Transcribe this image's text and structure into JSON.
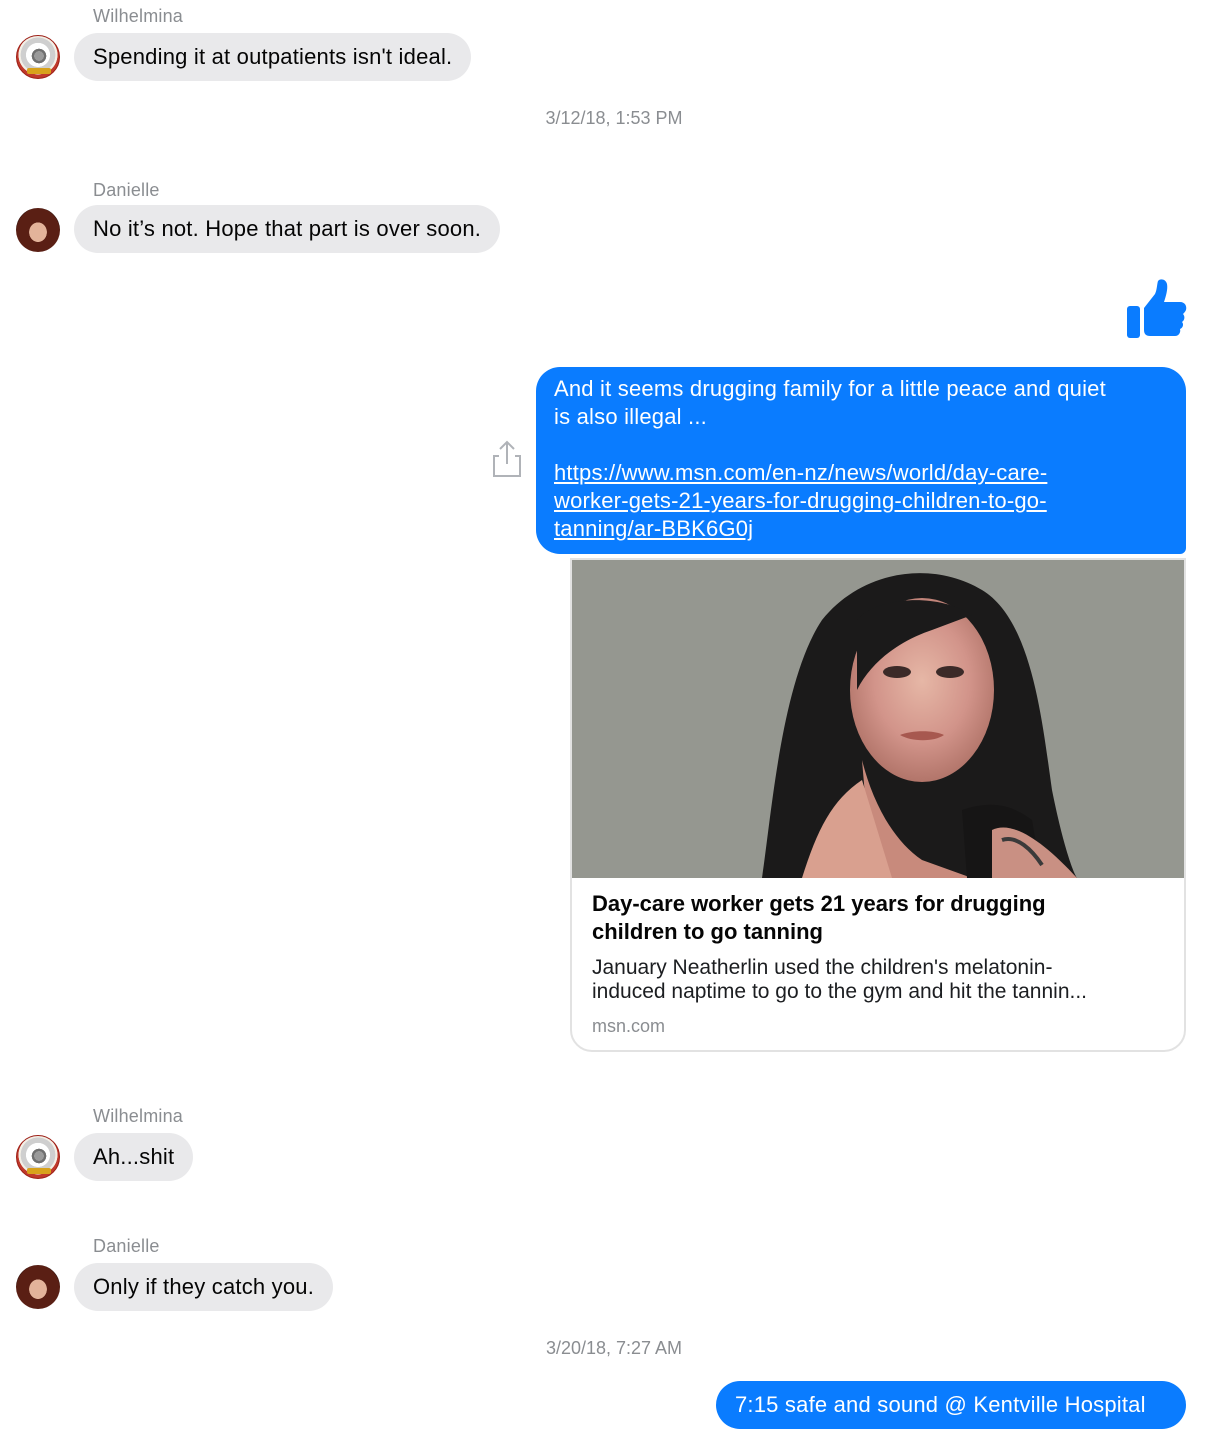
{
  "messages": [
    {
      "sender": "Wilhelmina",
      "text": "Spending it at outpatients isn't ideal."
    },
    {
      "timestamp": "3/12/18, 1:53 PM"
    },
    {
      "sender": "Danielle",
      "text": "No it’s not. Hope that part is over soon."
    },
    {
      "reaction": "thumbs-up-icon"
    },
    {
      "outgoing_text_line1": "And it seems drugging family for a little peace and quiet",
      "outgoing_text_line2": "is also illegal ...",
      "link_line1": "https://www.msn.com/en-nz/news/world/day-care-",
      "link_line2": "worker-gets-21-years-for-drugging-children-to-go-",
      "link_line3": "tanning/ar-BBK6G0j"
    },
    {
      "card_title_line1": "Day-care worker gets 21 years for drugging",
      "card_title_line2": "children to go tanning",
      "card_desc_line1": "January Neatherlin used the children's melatonin-",
      "card_desc_line2": "induced naptime to go to the gym and hit the tannin...",
      "card_domain": "msn.com"
    },
    {
      "sender": "Wilhelmina",
      "text": "Ah...shit"
    },
    {
      "sender": "Danielle",
      "text": "Only if they catch you."
    },
    {
      "timestamp": "3/20/18, 7:27 AM"
    },
    {
      "outgoing_text": "7:15 safe and sound @ Kentville Hospital"
    }
  ],
  "colors": {
    "outgoing_bubble": "#0a7cff",
    "incoming_bubble": "#e9e9eb",
    "meta_text": "#8a8d91"
  }
}
